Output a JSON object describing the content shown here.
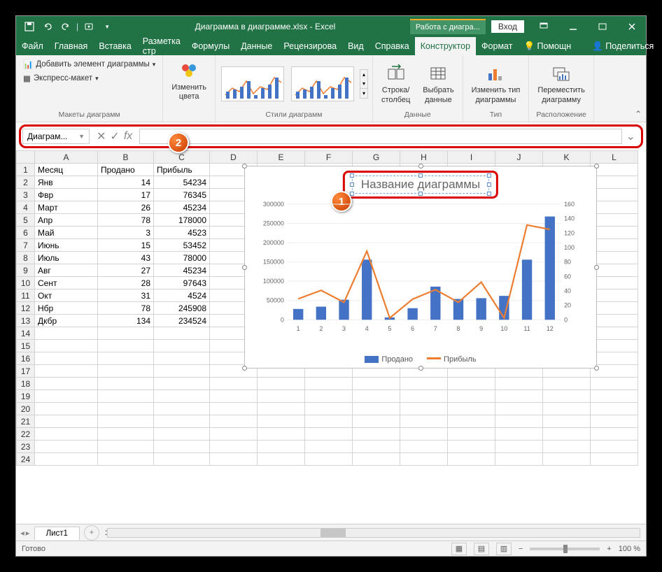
{
  "title": "Диаграмма в диаграмме.xlsx - Excel",
  "context_tab": "Работа с диагра...",
  "login_btn": "Вход",
  "tabs": [
    "Файл",
    "Главная",
    "Вставка",
    "Разметка стр",
    "Формулы",
    "Данные",
    "Рецензирова",
    "Вид",
    "Справка",
    "Конструктор",
    "Формат"
  ],
  "active_tab_index": 9,
  "share": {
    "help": "Помощн",
    "share": "Поделиться"
  },
  "ribbon": {
    "layouts": {
      "add_element": "Добавить элемент диаграммы",
      "quick_layout": "Экспресс-макет",
      "group": "Макеты диаграмм"
    },
    "colors": {
      "btn": "Изменить\nцвета"
    },
    "styles_group": "Стили диаграмм",
    "data": {
      "switch": "Строка/\nстолбец",
      "select": "Выбрать\nданные",
      "group": "Данные"
    },
    "type": {
      "change": "Изменить тип\nдиаграммы",
      "group": "Тип"
    },
    "location": {
      "move": "Переместить\nдиаграмму",
      "group": "Расположение"
    }
  },
  "namebox": "Диаграм...",
  "formula_value": "",
  "callouts": {
    "one": "1",
    "two": "2"
  },
  "columns": [
    "A",
    "B",
    "C",
    "D",
    "E",
    "F",
    "G",
    "H",
    "I",
    "J",
    "K",
    "L"
  ],
  "headers": {
    "a": "Месяц",
    "b": "Продано",
    "c": "Прибыль"
  },
  "rows": [
    {
      "n": 1,
      "a": "Месяц",
      "b": "Продано",
      "c": "Прибыль"
    },
    {
      "n": 2,
      "a": "Янв",
      "b": 14,
      "c": 54234
    },
    {
      "n": 3,
      "a": "Фвр",
      "b": 17,
      "c": 76345
    },
    {
      "n": 4,
      "a": "Март",
      "b": 26,
      "c": 45234
    },
    {
      "n": 5,
      "a": "Апр",
      "b": 78,
      "c": 178000
    },
    {
      "n": 6,
      "a": "Май",
      "b": 3,
      "c": 4523
    },
    {
      "n": 7,
      "a": "Июнь",
      "b": 15,
      "c": 53452
    },
    {
      "n": 8,
      "a": "Июль",
      "b": 43,
      "c": 78000
    },
    {
      "n": 9,
      "a": "Авг",
      "b": 27,
      "c": 45234
    },
    {
      "n": 10,
      "a": "Сент",
      "b": 28,
      "c": 97643
    },
    {
      "n": 11,
      "a": "Окт",
      "b": 31,
      "c": 4524
    },
    {
      "n": 12,
      "a": "Нбр",
      "b": 78,
      "c": 245908
    },
    {
      "n": 13,
      "a": "Дкбр",
      "b": 134,
      "c": 234524
    }
  ],
  "empty_rows": [
    14,
    15,
    16,
    17,
    18,
    19,
    20,
    21,
    22,
    23,
    24
  ],
  "chart": {
    "title": "Название диаграммы",
    "legend": {
      "s1": "Продано",
      "s2": "Прибыль"
    }
  },
  "chart_data": {
    "type": "combo",
    "categories": [
      1,
      2,
      3,
      4,
      5,
      6,
      7,
      8,
      9,
      10,
      11,
      12
    ],
    "series": [
      {
        "name": "Продано",
        "type": "line",
        "axis": "right",
        "values": [
          54234,
          76345,
          45234,
          178000,
          4523,
          53452,
          78000,
          45234,
          97643,
          4524,
          245908,
          234524
        ],
        "color": "#ed7d31"
      },
      {
        "name": "Прибыль",
        "type": "bar",
        "axis": "left",
        "values": [
          14,
          17,
          26,
          78,
          3,
          15,
          43,
          27,
          28,
          31,
          78,
          134
        ],
        "display_scale": 2000,
        "color": "#4472c4"
      }
    ],
    "y_left": {
      "min": 0,
      "max": 300000,
      "ticks": [
        0,
        50000,
        100000,
        150000,
        200000,
        250000,
        300000
      ]
    },
    "y_right": {
      "min": 0,
      "max": 160,
      "ticks": [
        0,
        20,
        40,
        60,
        80,
        100,
        120,
        140,
        160
      ]
    }
  },
  "sheet_tab": "Лист1",
  "status": "Готово",
  "zoom": "100 %",
  "colors": {
    "accent": "#217346",
    "bar": "#4472c4",
    "line": "#ed7d31",
    "highlight": "#d80000"
  }
}
